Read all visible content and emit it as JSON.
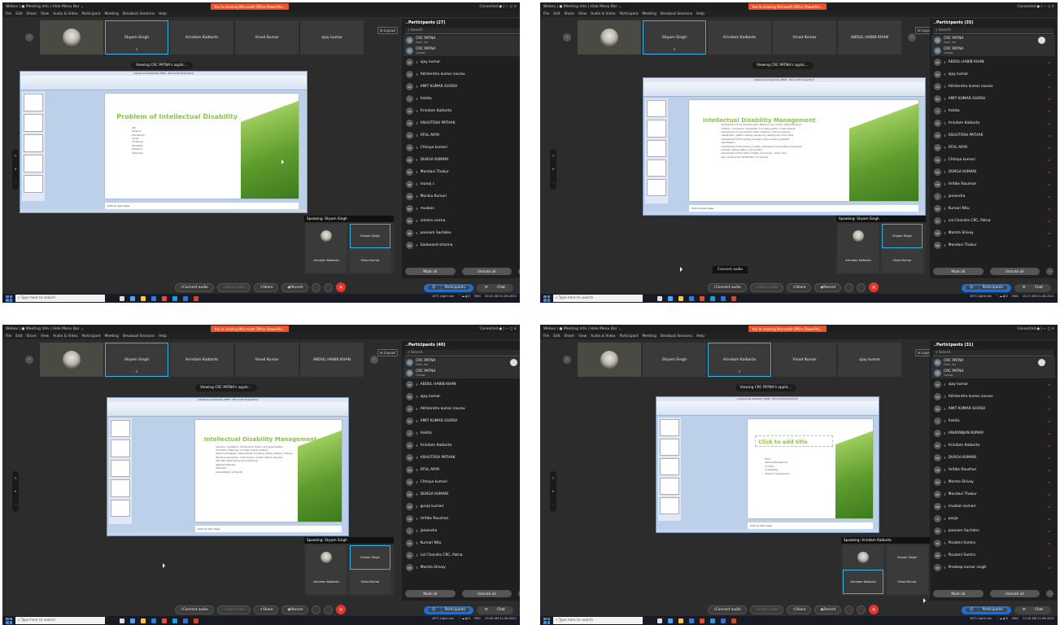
{
  "common": {
    "window_title": "Webex | ● Meeting Info | Hide Menu Bar ⌄",
    "share_banner": "You're sharing Microsoft Office PowerPoi...",
    "connection": "Connected ● | — ◻ ✕",
    "menu": [
      "File",
      "Edit",
      "Share",
      "View",
      "Audio & Video",
      "Participant",
      "Meeting",
      "Breakout Sessions",
      "Help"
    ],
    "layout_label": "Layout",
    "viewing": "Viewing CRC PATNA's applic...",
    "search_placeholder": "Search",
    "mute_all": "Mute all",
    "unmute_all": "Unmute all",
    "controls": {
      "audio": "Connect audio",
      "video": "Start video",
      "share": "Share",
      "record": "Record"
    },
    "participants_btn": "Participants",
    "chat_btn": "Chat",
    "taskbar_search": "Type here to search",
    "weather": "26°C Light rain",
    "lang": "ENG",
    "host_name": "CRC PATNA",
    "host_sub": "Host, me",
    "cohost_name": "CRC PATNA",
    "cohost_sub": "Cohost",
    "tile_names": {
      "shyam": "Shyam Singh",
      "arindam": "Arindam Kaibarta",
      "vinod": "Vinod Kumar",
      "ajay": "ajay kumar",
      "abdul": "ABDUL HABIB KHAN"
    },
    "notes": "Click to add notes",
    "ppt_title": "Intellectual Disability MDM - Microsoft PowerPoint"
  },
  "shots": [
    {
      "participants_header": "Participants (27)",
      "speaking": "Speaking: Shyam Singh",
      "time": "10:15 AM 21-06-2021",
      "slide_title": "Problem of Intellectual Disability",
      "bullets": [
        "ARI",
        "Personal",
        "Educational",
        "Social",
        "Vocational",
        "Recreation",
        "Behaviour",
        "Prevention"
      ],
      "list": [
        {
          "av": "AK",
          "name": "ajay kumar"
        },
        {
          "av": "AS",
          "name": "Akhilendra kumar saurav"
        },
        {
          "av": "AG",
          "name": "AMIT KUMAR GHOSH"
        },
        {
          "av": "A",
          "name": "Ankita"
        },
        {
          "av": "AK",
          "name": "Arindam Kaibarta"
        },
        {
          "av": "AP",
          "name": "ASHUTOSH PATHAK"
        },
        {
          "av": "AA",
          "name": "ATUL ARYA"
        },
        {
          "av": "CK",
          "name": "Chhaya kumari"
        },
        {
          "av": "DK",
          "name": "DURGA KUMARI"
        },
        {
          "av": "MT",
          "name": "Mandavi Thakur"
        },
        {
          "av": "MJ",
          "name": "manoj c"
        },
        {
          "av": "MK",
          "name": "Monika Kumari"
        },
        {
          "av": "MU",
          "name": "muskan"
        },
        {
          "av": "NV",
          "name": "nimma verma"
        },
        {
          "av": "PS",
          "name": "poonam Sachdev"
        },
        {
          "av": "SS",
          "name": "Sadanand sharma"
        }
      ]
    },
    {
      "participants_header": "Participants (35)",
      "speaking": "Speaking: Shyam Singh",
      "time": "10:17 AM 21-06-2021",
      "slide_title": "Intellectual Disability Management",
      "bullets": [
        "Development of pre-requisite skills: attention, eye contact, sitting tolerance,",
        "imitation, compliance, cooperation, turn-taking skills, on task behavior",
        "Development of pre-academic skills: matching, sorting, grouping,",
        "classification, pattern making, sequencing, labeling and colour skills",
        "Development of the reading concepts: picture reading, alphabet",
        "identification",
        "Development of the writing concepts: readiness and pre-writing movements",
        "(scribble, zigzag, pattern, joining dots)",
        "Development of the math concepts: such as big - small, more -",
        "less, counting and identification of numerals"
      ],
      "caption": "Connect audio",
      "list": [
        {
          "av": "AK",
          "name": "ABDUL HABIB KHAN"
        },
        {
          "av": "AK",
          "name": "ajay kumar"
        },
        {
          "av": "AS",
          "name": "Akhilendra kumar saurav"
        },
        {
          "av": "AG",
          "name": "AMIT KUMAR GHOSH"
        },
        {
          "av": "A",
          "name": "Ankita"
        },
        {
          "av": "AK",
          "name": "Arindam Kaibarta"
        },
        {
          "av": "AP",
          "name": "ASHUTOSH PATHAK"
        },
        {
          "av": "AA",
          "name": "ATUL ARYA"
        },
        {
          "av": "CK",
          "name": "Chhaya kumari"
        },
        {
          "av": "DK",
          "name": "DURGA KUMARI"
        },
        {
          "av": "HR",
          "name": "Hritike Raushan"
        },
        {
          "av": "J",
          "name": "jainendra"
        },
        {
          "av": "KN",
          "name": "Kumari Nitu"
        },
        {
          "av": "LC",
          "name": "Lal Chandra CRC, Patna"
        },
        {
          "av": "MS",
          "name": "Mamta Shivay"
        },
        {
          "av": "MT",
          "name": "Mandavi Thakur"
        }
      ]
    },
    {
      "participants_header": "Participants (40)",
      "speaking": "Speaking: Shyam Singh",
      "time": "10:45 AM 21-06-2021",
      "slide_title": "Intellectual Disability Management",
      "bullets": [
        "Learning - Acquisition, maintenance, fluency and generalization",
        "Principles of Teaching: concrete, simple, symbolic",
        "Teaching Strategies : task analysis, prompting, fading, shaping, chaining",
        "Teaching Approaches : multi sensory, project method, play way",
        "Peer tutor teaching and group teaching",
        "Selective Attention",
        "Motivation",
        "Generalization & Transfer"
      ],
      "list": [
        {
          "av": "AK",
          "name": "ABDUL HABIB KHAN"
        },
        {
          "av": "AK",
          "name": "ajay kumar"
        },
        {
          "av": "AS",
          "name": "Akhilendra kumar saurav"
        },
        {
          "av": "AG",
          "name": "AMIT KUMAR GHOSH"
        },
        {
          "av": "A",
          "name": "Ankita"
        },
        {
          "av": "AK",
          "name": "Arindam Kaibarta"
        },
        {
          "av": "AP",
          "name": "ASHUTOSH PATHAK"
        },
        {
          "av": "AA",
          "name": "ATUL ARYA"
        },
        {
          "av": "CK",
          "name": "Chhaya kumari"
        },
        {
          "av": "DK",
          "name": "DURGA KUMARI"
        },
        {
          "av": "GK",
          "name": "gunja kumari"
        },
        {
          "av": "HR",
          "name": "Hritike Raushan"
        },
        {
          "av": "J",
          "name": "jainendra"
        },
        {
          "av": "KN",
          "name": "Kumari Nitu"
        },
        {
          "av": "LC",
          "name": "Lal Chandra CRC, Patna"
        },
        {
          "av": "MS",
          "name": "Mamta Shivay"
        }
      ]
    },
    {
      "participants_header": "Participants (31)",
      "speaking": "Speaking: Arindam Kaibarta",
      "time": "11:10 AM 21-06-2021",
      "slide_title": "Click to add title",
      "bullets": [
        "Ethic",
        "Medical Management",
        "Inclusion",
        "Accessibility",
        "Behavior management"
      ],
      "list": [
        {
          "av": "AK",
          "name": "ajay kumar"
        },
        {
          "av": "AS",
          "name": "Akhilendra kumar saurav"
        },
        {
          "av": "AG",
          "name": "AMIT KUMAR GHOSH"
        },
        {
          "av": "A",
          "name": "Ankita"
        },
        {
          "av": "AK",
          "name": "ANURANJAN KUMAR"
        },
        {
          "av": "AK",
          "name": "Arindam Kaibarta"
        },
        {
          "av": "DK",
          "name": "DURGA KUMARI"
        },
        {
          "av": "HR",
          "name": "Hritike Raushan"
        },
        {
          "av": "MS",
          "name": "Mamta Shivay"
        },
        {
          "av": "MT",
          "name": "Mandavi Thakur"
        },
        {
          "av": "MK",
          "name": "muskan kumari"
        },
        {
          "av": "P",
          "name": "pooja"
        },
        {
          "av": "PS",
          "name": "poonam Sachdev"
        },
        {
          "av": "PS",
          "name": "Poulami Santra"
        },
        {
          "av": "PS",
          "name": "Poulami Santra"
        },
        {
          "av": "PS",
          "name": "Pradeep kumar singh"
        }
      ]
    }
  ]
}
